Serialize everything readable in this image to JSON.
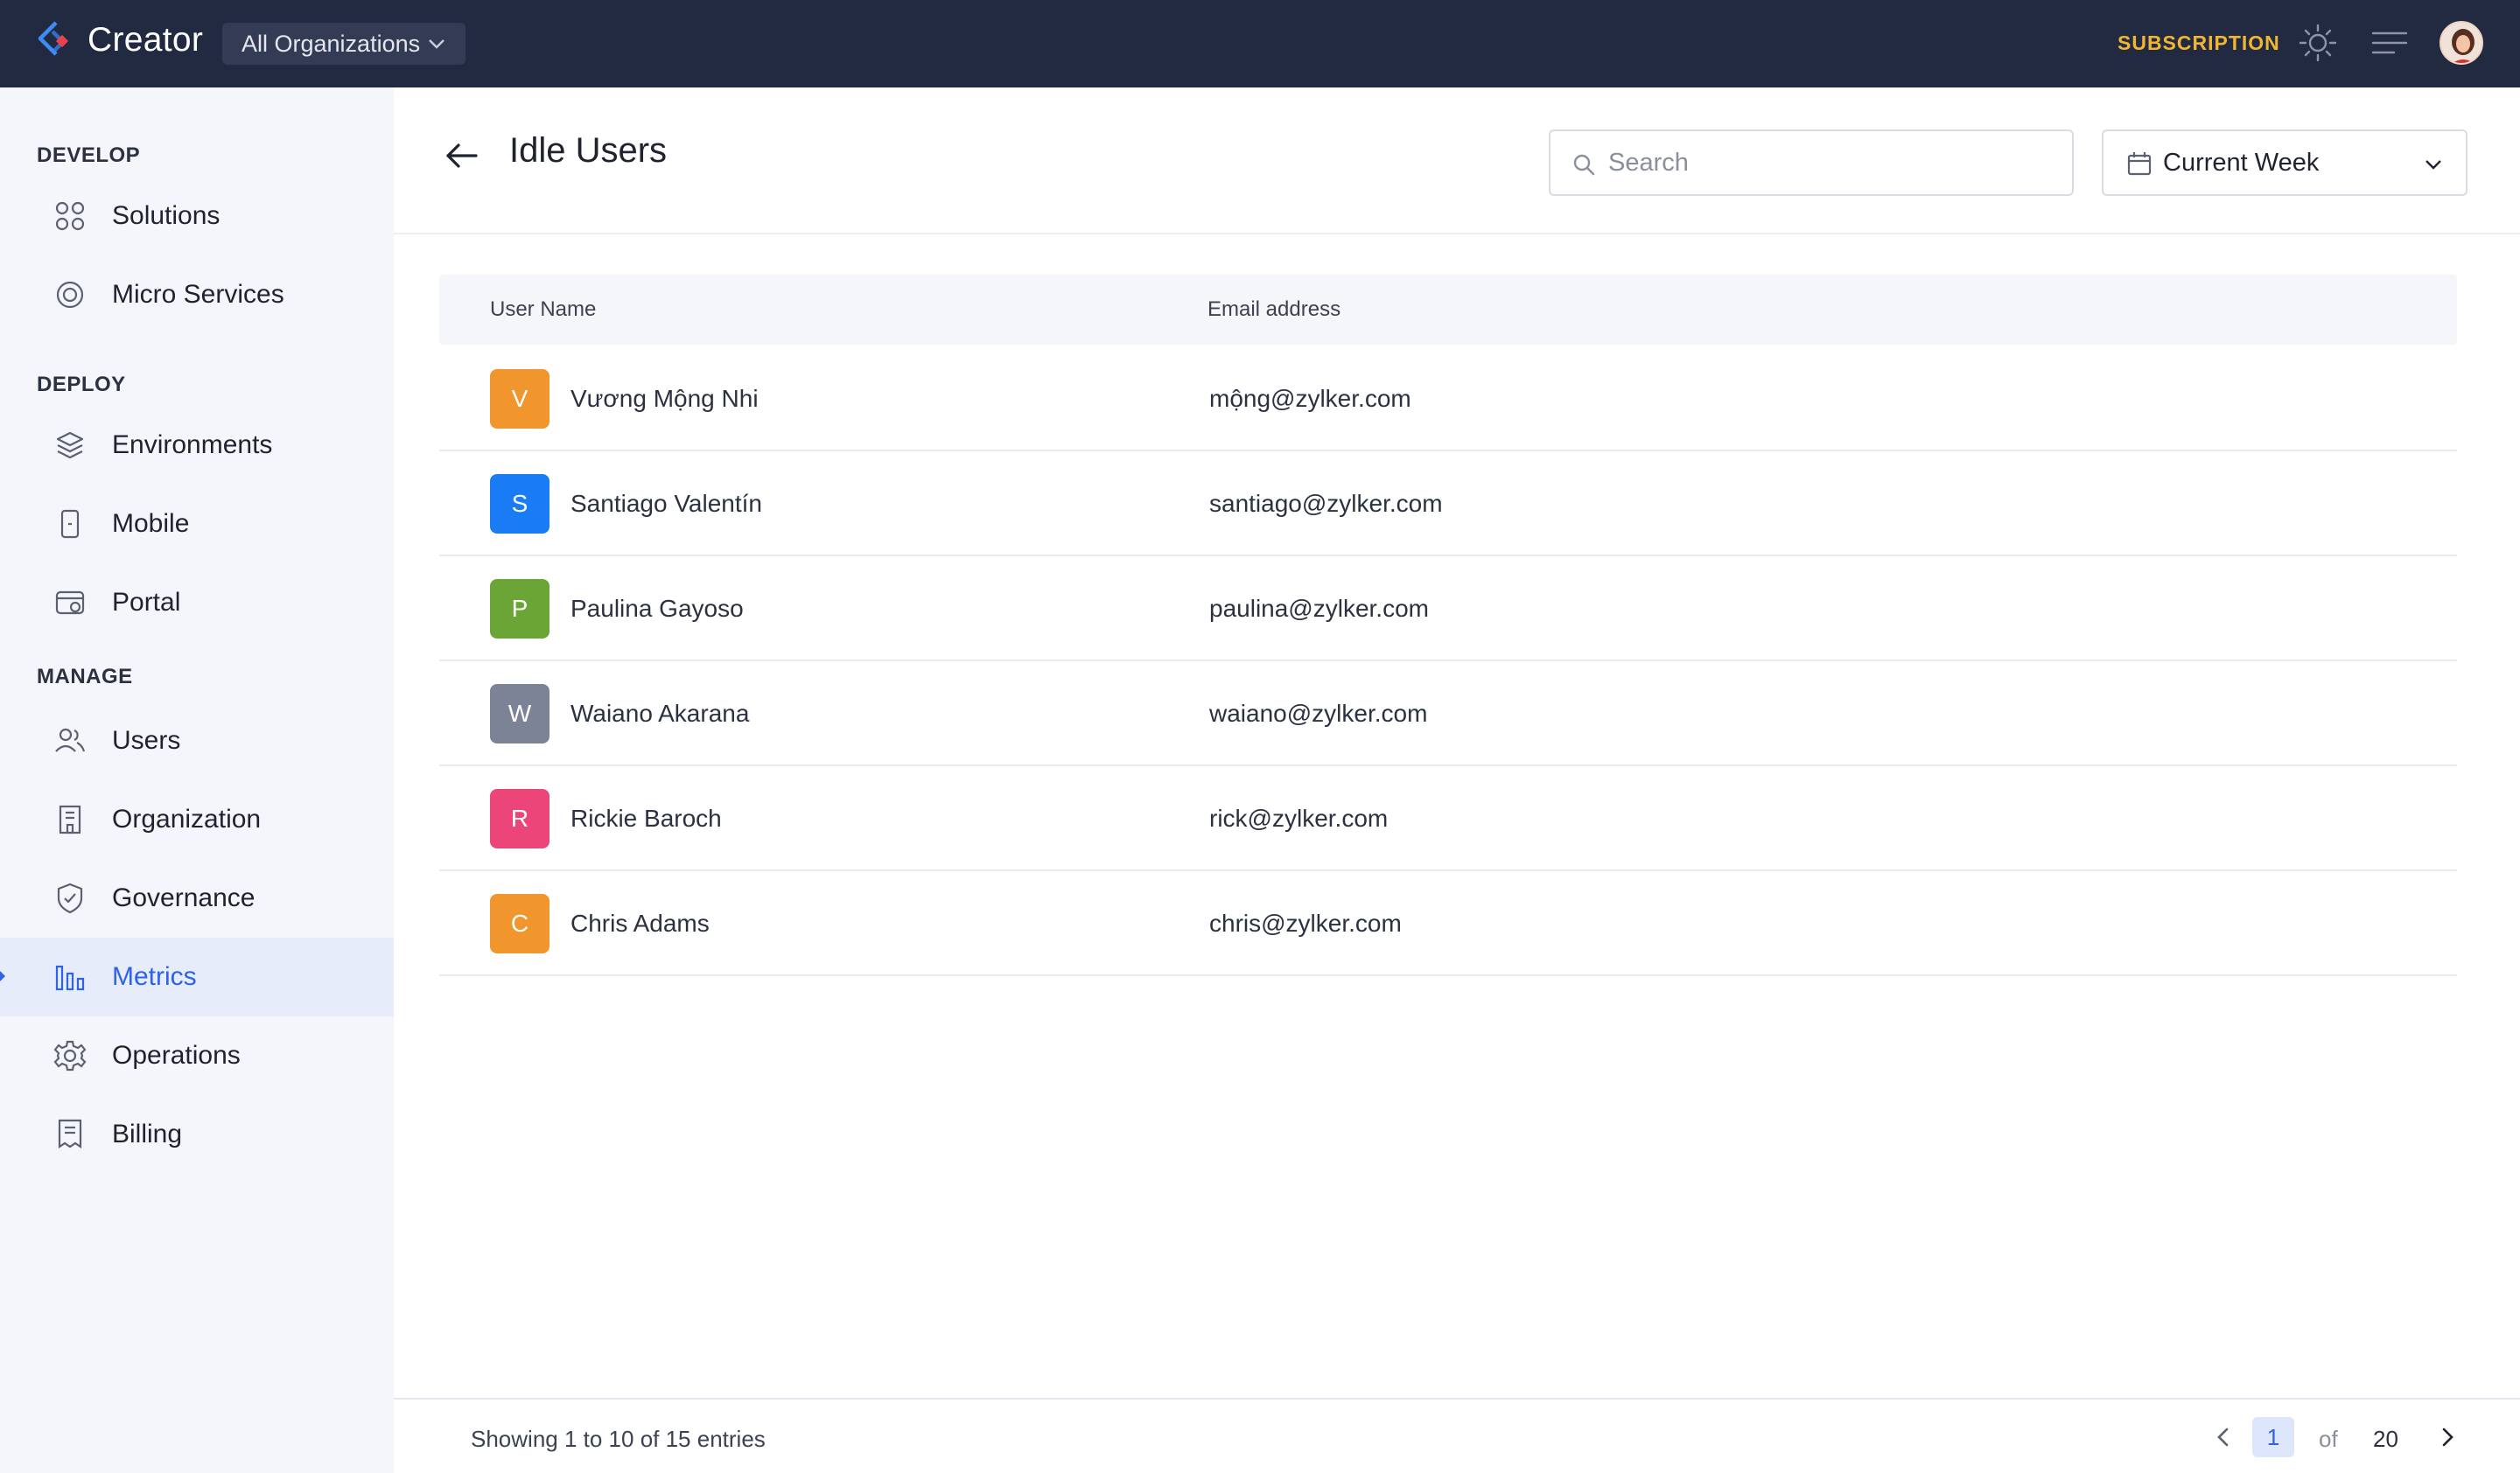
{
  "topbar": {
    "brand": "Creator",
    "org_selector": "All Organizations",
    "subscription": "SUBSCRIPTION",
    "icons": [
      "logo-icon",
      "chevron-down-icon",
      "sun-icon",
      "menu-icon",
      "user-avatar"
    ]
  },
  "sidebar": {
    "sections": [
      {
        "title": "DEVELOP"
      },
      {
        "title": "DEPLOY"
      },
      {
        "title": "MANAGE"
      }
    ],
    "items": [
      {
        "label": "Solutions",
        "icon": "grid-icon"
      },
      {
        "label": "Micro Services",
        "icon": "microservice-icon"
      },
      {
        "label": "Environments",
        "icon": "layers-icon"
      },
      {
        "label": "Mobile",
        "icon": "mobile-icon"
      },
      {
        "label": "Portal",
        "icon": "portal-icon"
      },
      {
        "label": "Users",
        "icon": "users-icon"
      },
      {
        "label": "Organization",
        "icon": "building-icon"
      },
      {
        "label": "Governance",
        "icon": "shield-icon"
      },
      {
        "label": "Metrics",
        "icon": "bar-chart-icon",
        "active": true
      },
      {
        "label": "Operations",
        "icon": "gear-icon"
      },
      {
        "label": "Billing",
        "icon": "receipt-icon"
      }
    ]
  },
  "main": {
    "title": "Idle Users",
    "search": {
      "placeholder": "Search",
      "value": ""
    },
    "period": "Current Week",
    "table": {
      "columns": [
        "User Name",
        "Email address"
      ],
      "rows": [
        {
          "initial": "V",
          "name": "Vương Mộng Nhi",
          "email": "mộng@zylker.com",
          "color": "#f0962d"
        },
        {
          "initial": "S",
          "name": "Santiago Valentín",
          "email": "santiago@zylker.com",
          "color": "#1a7cf5"
        },
        {
          "initial": "P",
          "name": "Paulina Gayoso",
          "email": "paulina@zylker.com",
          "color": "#6aa536"
        },
        {
          "initial": "W",
          "name": "Waiano Akarana",
          "email": "waiano@zylker.com",
          "color": "#7d8397"
        },
        {
          "initial": "R",
          "name": "Rickie Baroch",
          "email": "rick@zylker.com",
          "color": "#ec4679"
        },
        {
          "initial": "C",
          "name": "Chris Adams",
          "email": "chris@zylker.com",
          "color": "#f0962d"
        }
      ]
    },
    "footer": {
      "showing": "Showing 1 to 10 of 15 entries",
      "current_page": "1",
      "of": "of",
      "total_pages": "20"
    }
  },
  "colors": {
    "topbar_bg": "#222a41",
    "accent": "#2f63e6",
    "subscription": "#f2b531",
    "sidebar_bg": "#f5f6fb",
    "active_bg": "#e7ecfb"
  }
}
